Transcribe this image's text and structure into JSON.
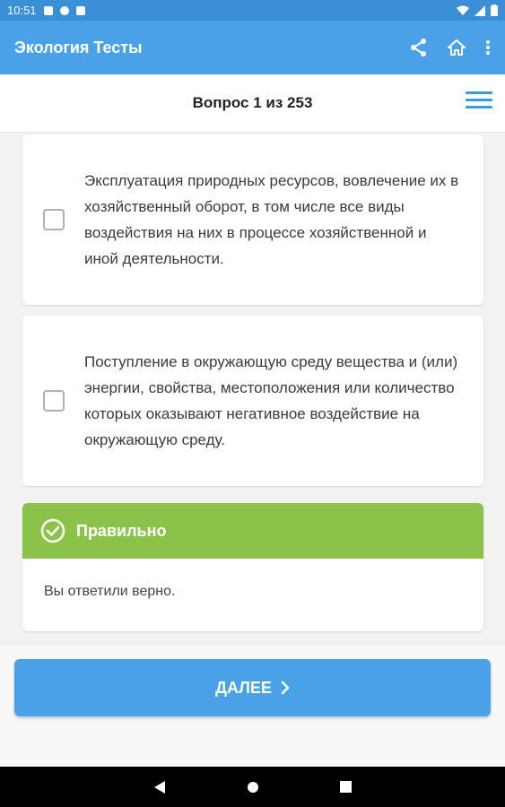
{
  "status_bar": {
    "time": "10:51"
  },
  "app_bar": {
    "title": "Экология Тесты",
    "actions": [
      "share-icon",
      "home-icon",
      "more-vert-icon"
    ]
  },
  "question": {
    "counter": "Вопрос 1 из 253"
  },
  "answers": [
    {
      "text": "Эксплуатация природных ресурсов, вовлечение их в хозяйственный оборот, в том числе все виды воздействия на них в процессе хозяйственной и иной деятельности.",
      "checked": false
    },
    {
      "text": "Поступление в окружающую среду вещества и (или) энергии, свойства, местоположения или количество которых оказывают негативное воздействие на окружающую среду.",
      "checked": false
    }
  ],
  "result": {
    "title": "Правильно",
    "message": "Вы ответили верно.",
    "color": "#8bc34a"
  },
  "next_button": {
    "label": "ДАЛЕЕ"
  },
  "colors": {
    "primary": "#4aa1e8",
    "status_bar": "#3b8fd6",
    "success": "#8bc34a"
  }
}
